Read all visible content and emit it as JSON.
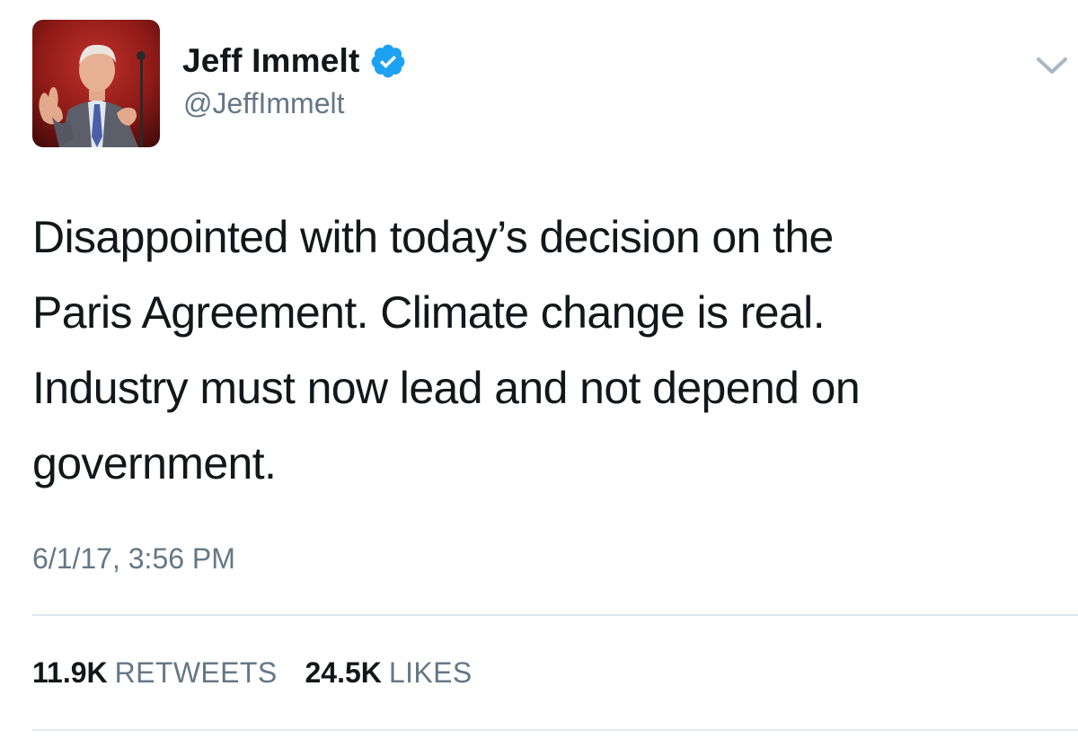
{
  "tweet": {
    "author": {
      "name": "Jeff Immelt",
      "handle": "@JeffImmelt",
      "verified": true
    },
    "text_lines": [
      "Disappointed with today’s decision on the",
      "Paris Agreement. Climate change is real.",
      "Industry must now lead and not depend on",
      "government."
    ],
    "timestamp": "6/1/17, 3:56 PM",
    "stats": {
      "retweets_count": "11.9K",
      "retweets_label": "RETWEETS",
      "likes_count": "24.5K",
      "likes_label": "LIKES"
    }
  },
  "colors": {
    "text_primary": "#14171a",
    "text_secondary": "#657786",
    "verified_badge": "#1da1f2",
    "divider": "#e1e8ed",
    "chevron": "#aab8c2"
  },
  "icons": {
    "verified": "verified-badge-icon",
    "menu": "chevron-down-icon"
  }
}
